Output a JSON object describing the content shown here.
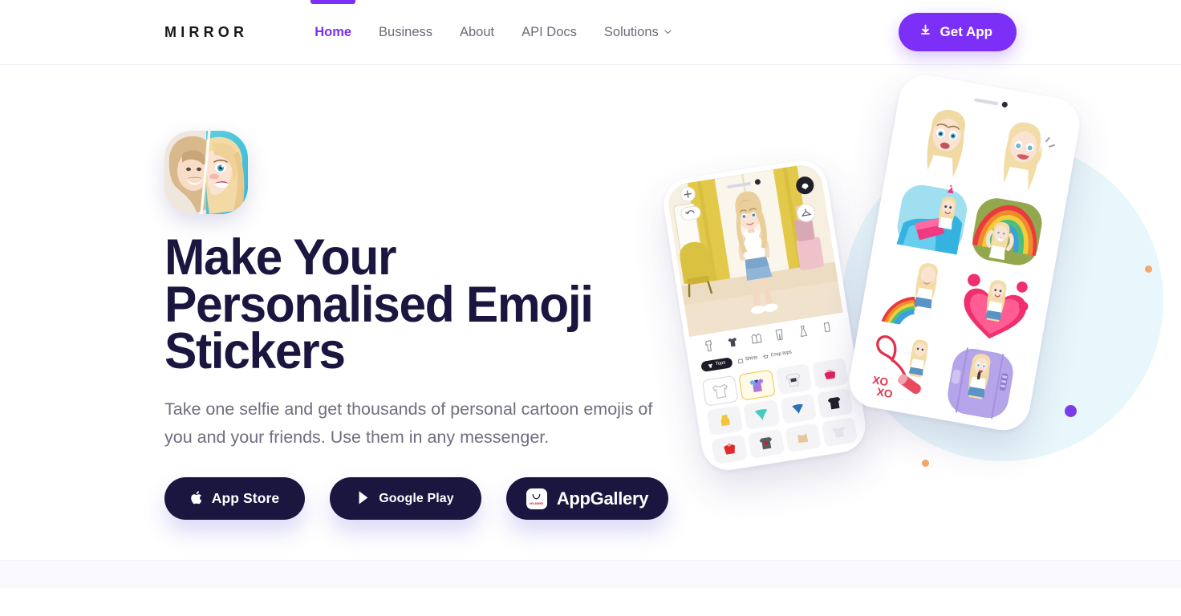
{
  "brand": {
    "logo": "MIRROR",
    "accent_color": "#7b2ff7",
    "dark_color": "#1b1640"
  },
  "header": {
    "nav": [
      {
        "label": "Home",
        "active": true,
        "has_dropdown": false
      },
      {
        "label": "Business",
        "active": false,
        "has_dropdown": false
      },
      {
        "label": "About",
        "active": false,
        "has_dropdown": false
      },
      {
        "label": "API Docs",
        "active": false,
        "has_dropdown": false
      },
      {
        "label": "Solutions",
        "active": false,
        "has_dropdown": true
      }
    ],
    "cta": {
      "label": "Get App",
      "icon": "download-icon"
    }
  },
  "hero": {
    "avatar_icon": "app-avatar-half-photo-half-cartoon",
    "headline": "Make Your Personalised Emoji Stickers",
    "subhead": "Take one selfie and get thousands of personal cartoon emojis of you and your friends. Use them in any messenger.",
    "store_buttons": [
      {
        "id": "app-store",
        "label": "App Store",
        "icon": "apple-icon"
      },
      {
        "id": "google-play",
        "label": "Google Play",
        "icon": "google-play-icon"
      },
      {
        "id": "app-gallery",
        "label": "AppGallery",
        "icon": "huawei-appgallery-icon",
        "badge_text": "HUAWEI"
      }
    ]
  },
  "artwork": {
    "left_phone": {
      "name": "wardrobe-editor-phone",
      "tabs": [
        {
          "label": "Tops",
          "active": true
        },
        {
          "label": "Shirts",
          "active": false
        },
        {
          "label": "Crop tops",
          "active": false
        }
      ]
    },
    "right_phone": {
      "name": "sticker-pack-phone",
      "sticker_count": 8
    },
    "dots": [
      {
        "name": "dot-cyan",
        "color": "#31c8e3"
      },
      {
        "name": "dot-orange",
        "color": "#f6a86a"
      },
      {
        "name": "dot-purple",
        "color": "#7b3ce8"
      },
      {
        "name": "dot-orange-2",
        "color": "#f6a86a"
      }
    ],
    "blob_color": "#e8f7fb"
  }
}
